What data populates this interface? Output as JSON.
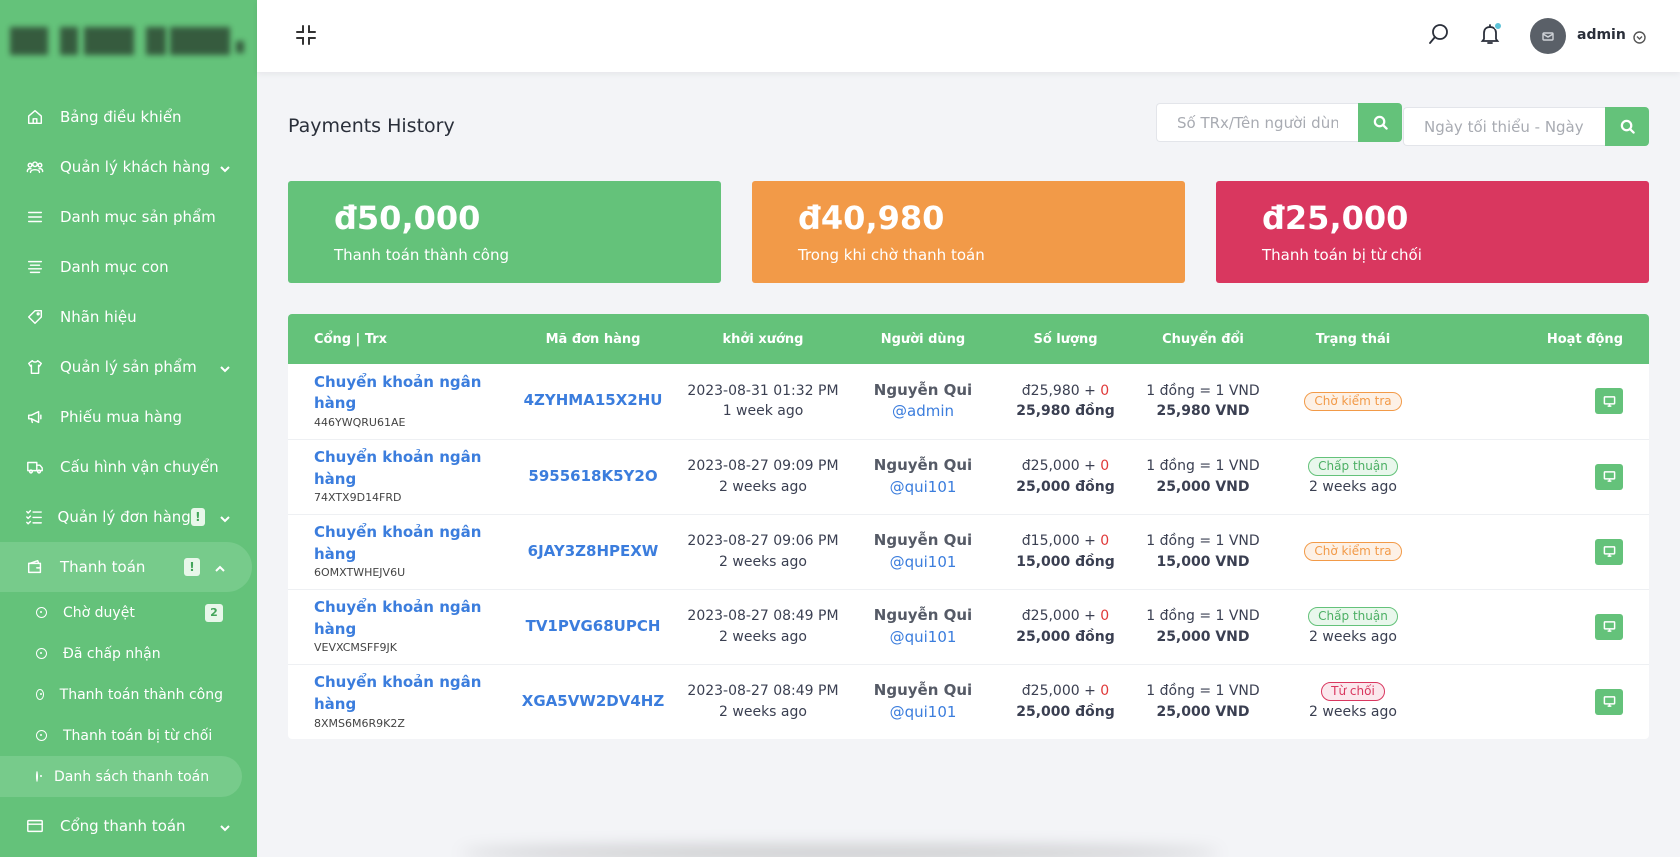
{
  "sidebar": {
    "items": [
      {
        "label": "Bảng điều khiển",
        "icon": "home-icon"
      },
      {
        "label": "Quản lý khách hàng",
        "icon": "users-icon"
      },
      {
        "label": "Danh mục sản phẩm",
        "icon": "list-icon"
      },
      {
        "label": "Danh mục con",
        "icon": "align-icon"
      },
      {
        "label": "Nhãn hiệu",
        "icon": "tag-icon"
      },
      {
        "label": "Quản lý sản phẩm",
        "icon": "shirt-icon"
      },
      {
        "label": "Phiếu mua hàng",
        "icon": "megaphone-icon"
      },
      {
        "label": "Cấu hình vận chuyển",
        "icon": "truck-icon"
      },
      {
        "label": "Quản lý đơn hàng",
        "icon": "checklist-icon",
        "badge": "!"
      },
      {
        "label": "Thanh toán",
        "icon": "wallet-icon",
        "badge": "!"
      },
      {
        "label": "Cổng thanh toán",
        "icon": "credit-card-icon"
      }
    ],
    "payment_sub": [
      {
        "label": "Chờ duyệt",
        "count": "2"
      },
      {
        "label": "Đã chấp nhận"
      },
      {
        "label": "Thanh toán thành công"
      },
      {
        "label": "Thanh toán bị từ chối"
      },
      {
        "label": "Danh sách thanh toán"
      }
    ]
  },
  "topbar": {
    "user_name": "admin"
  },
  "page": {
    "title": "Payments History",
    "search_placeholder": "Số TRx/Tên người dùng",
    "date_placeholder": "Ngày tối thiểu - Ngày tối đa"
  },
  "cards": [
    {
      "amount": "đ50,000",
      "label": "Thanh toán thành công",
      "color": "#64c27a"
    },
    {
      "amount": "đ40,980",
      "label": "Trong khi chờ thanh toán",
      "color": "#f29a48"
    },
    {
      "amount": "đ25,000",
      "label": "Thanh toán bị từ chối",
      "color": "#d9375f"
    }
  ],
  "table": {
    "headers": [
      "Cổng | Trx",
      "Mã đơn hàng",
      "khởi xướng",
      "Người dùng",
      "Số lượng",
      "Chuyển đổi",
      "Trạng thái",
      "Hoạt động"
    ],
    "rows": [
      {
        "gateway": "Chuyển khoản ngân hàng",
        "trx": "446YWQRU61AE",
        "order": "4ZYHMA15X2HU",
        "date": "2023-08-31 01:32 PM",
        "ago": "1 week ago",
        "user": "Nguyễn Qui",
        "handle": "@admin",
        "amount": "đ25,980 + ",
        "charge": "0",
        "total": "25,980 đồng",
        "rate": "1 đồng = 1 VND",
        "converted": "25,980 VND",
        "status": "Chờ kiểm tra",
        "status_type": "pending",
        "status_ago": ""
      },
      {
        "gateway": "Chuyển khoản ngân hàng",
        "trx": "74XTX9D14FRD",
        "order": "5955618K5Y2O",
        "date": "2023-08-27 09:09 PM",
        "ago": "2 weeks ago",
        "user": "Nguyễn Qui",
        "handle": "@qui101",
        "amount": "đ25,000 + ",
        "charge": "0",
        "total": "25,000 đồng",
        "rate": "1 đồng = 1 VND",
        "converted": "25,000 VND",
        "status": "Chấp thuận",
        "status_type": "approved",
        "status_ago": "2 weeks ago"
      },
      {
        "gateway": "Chuyển khoản ngân hàng",
        "trx": "6OMXTWHEJV6U",
        "order": "6JAY3Z8HPEXW",
        "date": "2023-08-27 09:06 PM",
        "ago": "2 weeks ago",
        "user": "Nguyễn Qui",
        "handle": "@qui101",
        "amount": "đ15,000 + ",
        "charge": "0",
        "total": "15,000 đồng",
        "rate": "1 đồng = 1 VND",
        "converted": "15,000 VND",
        "status": "Chờ kiểm tra",
        "status_type": "pending",
        "status_ago": ""
      },
      {
        "gateway": "Chuyển khoản ngân hàng",
        "trx": "VEVXCMSFF9JK",
        "order": "TV1PVG68UPCH",
        "date": "2023-08-27 08:49 PM",
        "ago": "2 weeks ago",
        "user": "Nguyễn Qui",
        "handle": "@qui101",
        "amount": "đ25,000 + ",
        "charge": "0",
        "total": "25,000 đồng",
        "rate": "1 đồng = 1 VND",
        "converted": "25,000 VND",
        "status": "Chấp thuận",
        "status_type": "approved",
        "status_ago": "2 weeks ago"
      },
      {
        "gateway": "Chuyển khoản ngân hàng",
        "trx": "8XMS6M6R9K2Z",
        "order": "XGA5VW2DV4HZ",
        "date": "2023-08-27 08:49 PM",
        "ago": "2 weeks ago",
        "user": "Nguyễn Qui",
        "handle": "@qui101",
        "amount": "đ25,000 + ",
        "charge": "0",
        "total": "25,000 đồng",
        "rate": "1 đồng = 1 VND",
        "converted": "25,000 VND",
        "status": "Từ chối",
        "status_type": "rejected",
        "status_ago": "2 weeks ago"
      }
    ]
  },
  "colors": {
    "accent": "#64c27a",
    "orange": "#f29a48",
    "red": "#d9375f",
    "link": "#3b7ddd"
  }
}
